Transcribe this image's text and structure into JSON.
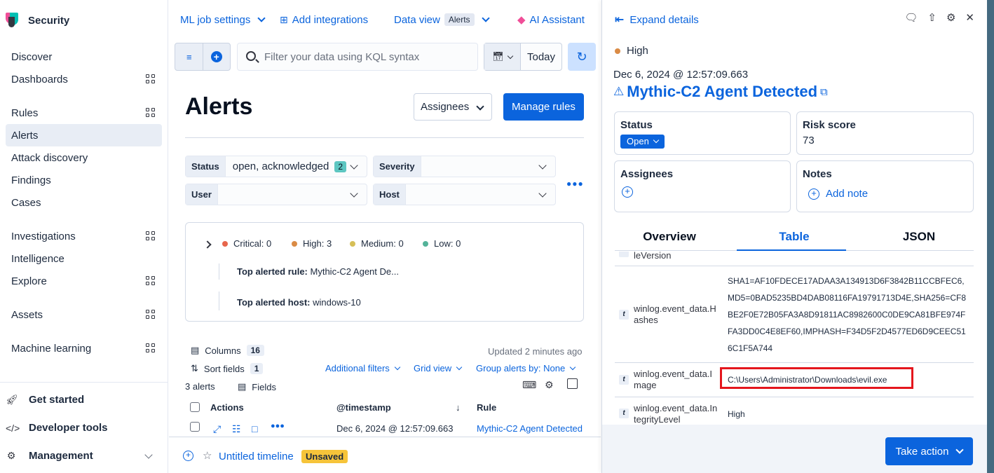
{
  "sidebar": {
    "brand": "Security",
    "items": [
      {
        "label": "Discover"
      },
      {
        "label": "Dashboards"
      },
      {
        "label": "Rules"
      },
      {
        "label": "Alerts"
      },
      {
        "label": "Attack discovery"
      },
      {
        "label": "Findings"
      },
      {
        "label": "Cases"
      },
      {
        "label": "Investigations"
      },
      {
        "label": "Intelligence"
      },
      {
        "label": "Explore"
      },
      {
        "label": "Assets"
      },
      {
        "label": "Machine learning"
      }
    ],
    "footer": [
      {
        "label": "Get started",
        "icon": "rocket-icon"
      },
      {
        "label": "Developer tools",
        "icon": "code-icon"
      },
      {
        "label": "Management",
        "icon": "gear-icon"
      }
    ]
  },
  "topbar": {
    "ml_job_settings": "ML job settings",
    "add_integrations": "Add integrations",
    "data_view_label": "Data view",
    "data_view_value": "Alerts",
    "ai_assistant": "AI Assistant"
  },
  "query": {
    "placeholder": "Filter your data using KQL syntax",
    "date_label": "Today"
  },
  "page": {
    "title": "Alerts",
    "assignees_button": "Assignees",
    "manage_rules_button": "Manage rules"
  },
  "filters": {
    "status_label": "Status",
    "status_value": "open, acknowledged",
    "status_count": "2",
    "severity_label": "Severity",
    "user_label": "User",
    "host_label": "Host"
  },
  "summary": {
    "critical": "Critical: 0",
    "high": "High: 3",
    "medium": "Medium: 0",
    "low": "Low: 0",
    "top_rule_label": "Top alerted rule:",
    "top_rule_value": "Mythic-C2 Agent De...",
    "top_host_label": "Top alerted host:",
    "top_host_value": "windows-10",
    "colors": {
      "critical": "#e7664c",
      "high": "#da8b45",
      "medium": "#d6bf57",
      "low": "#54b399"
    }
  },
  "table_tools": {
    "columns_label": "Columns",
    "columns_count": "16",
    "sort_label": "Sort fields",
    "sort_count": "1",
    "updated": "Updated 2 minutes ago",
    "additional_filters": "Additional filters",
    "grid_view": "Grid view",
    "group_by": "Group alerts by: None",
    "alerts_count": "3 alerts",
    "fields_label": "Fields"
  },
  "grid": {
    "headers": [
      "Actions",
      "@timestamp",
      "Rule"
    ],
    "rows": [
      {
        "timestamp": "Dec 6, 2024 @ 12:57:09.663",
        "rule": "Mythic-C2 Agent Detected"
      }
    ]
  },
  "timeline": {
    "title": "Untitled timeline",
    "badge": "Unsaved"
  },
  "flyout": {
    "expand_details": "Expand details",
    "severity": "High",
    "date": "Dec 6, 2024 @ 12:57:09.663",
    "title": "Mythic-C2 Agent Detected",
    "status_title": "Status",
    "status_value": "Open",
    "risk_title": "Risk score",
    "risk_value": "73",
    "assignees_title": "Assignees",
    "notes_title": "Notes",
    "add_note": "Add note",
    "tabs": [
      "Overview",
      "Table",
      "JSON"
    ],
    "rows": [
      {
        "field": "leVersion",
        "value": ""
      },
      {
        "field": "winlog.event_data.Hashes",
        "value": "SHA1=AF10FDECE17ADAA3A134913D6F3842B11CCBFEC6,MD5=0BAD5235BD4DAB08116FA19791713D4E,SHA256=CF8BE2F0E72B05FA3A8D91811AC8982600C0DE9CA81BFE974FFA3DD0C4E8EF60,IMPHASH=F34D5F2D4577ED6D9CEEC516C1F5A744"
      },
      {
        "field": "winlog.event_data.Image",
        "value": "C:\\Users\\Administrator\\Downloads\\evil.exe"
      },
      {
        "field": "winlog.event_data.IntegrityLevel",
        "value": "High"
      }
    ],
    "take_action": "Take action",
    "severity_color": "#da8b45",
    "highlight_color": "#e4161d"
  }
}
